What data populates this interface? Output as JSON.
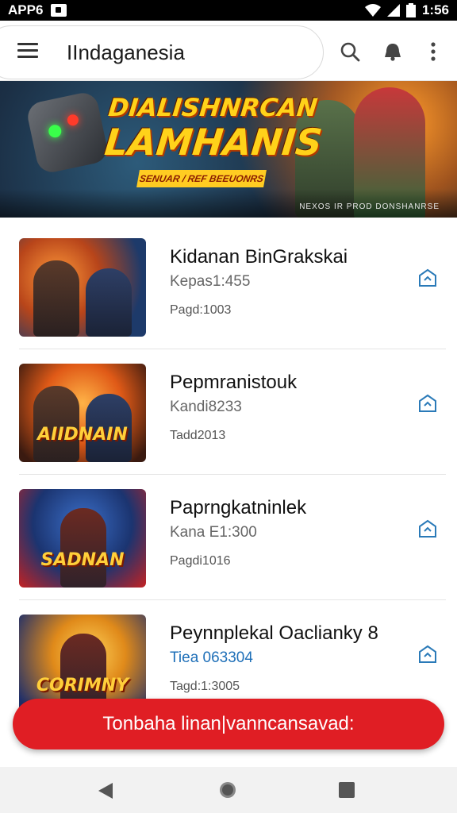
{
  "status_bar": {
    "left_text": "APP6",
    "time": "1:56"
  },
  "app_bar": {
    "title": "IIndaganesia"
  },
  "banner": {
    "title_line1": "DIALISHNRCAN",
    "title_line2": "LAMHANIS",
    "tagline": "SENUAR / REF BEEUONRS",
    "credit": "NEXOS IR PROD DONSHANRSE"
  },
  "items": [
    {
      "title": "Kidanan BinGrakskai",
      "subtitle": "Kepas1:455",
      "meta": "Pagd:1003",
      "thumb_logo": ""
    },
    {
      "title": "Pepmranistouk",
      "subtitle": "Kandi8233",
      "meta": "Tadd2013",
      "thumb_logo": "AIIDNAIN"
    },
    {
      "title": "Paprngkatninlek",
      "subtitle": "Kana E1:300",
      "meta": "Pagdi1016",
      "thumb_logo": "SADNAN"
    },
    {
      "title": "Peynnplekal Oaclianky 8",
      "subtitle": "Tiea 063304",
      "meta": "Tagd:1:3005",
      "thumb_logo": "CORIMNY"
    }
  ],
  "fab": {
    "label": "Tonbaha linan|vanncansavad:"
  },
  "icons": {
    "menu": "menu-icon",
    "search": "search-icon",
    "notification": "bell-icon",
    "more": "more-vert-icon",
    "item_action": "tag-icon"
  }
}
